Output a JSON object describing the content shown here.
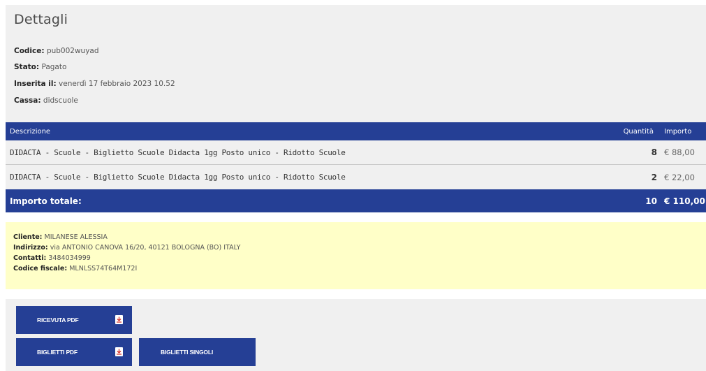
{
  "details": {
    "title": "Dettagli",
    "codice_label": "Codice:",
    "codice_value": "pub002wuyad",
    "stato_label": "Stato:",
    "stato_value": "Pagato",
    "inserita_label": "Inserita il:",
    "inserita_value": "venerdì 17 febbraio 2023 10.52",
    "cassa_label": "Cassa:",
    "cassa_value": "didscuole"
  },
  "table": {
    "headers": {
      "description": "Descrizione",
      "quantity": "Quantità",
      "amount": "Importo"
    },
    "rows": [
      {
        "description": "DIDACTA - Scuole - Biglietto Scuole Didacta 1gg Posto unico - Ridotto Scuole",
        "quantity": "8",
        "amount": "€ 88,00"
      },
      {
        "description": "DIDACTA - Scuole - Biglietto Scuole Didacta 1gg Posto unico - Ridotto Scuole",
        "quantity": "2",
        "amount": "€ 22,00"
      }
    ],
    "total": {
      "label": "Importo totale:",
      "quantity": "10",
      "amount": "€ 110,00"
    }
  },
  "client": {
    "cliente_label": "Cliente:",
    "cliente_value": "MILANESE ALESSIA",
    "indirizzo_label": "Indirizzo:",
    "indirizzo_value": "via ANTONIO CANOVA 16/20, 40121 BOLOGNA (BO) ITALY",
    "contatti_label": "Contatti:",
    "contatti_value": "3484034999",
    "cf_label": "Codice fiscale:",
    "cf_value": "MLNLSS74T64M172I"
  },
  "actions": {
    "ricevuta_pdf": "RICEVUTA PDF",
    "biglietti_pdf": "BIGLIETTI PDF",
    "biglietti_singoli": "BIGLIETTI SINGOLI"
  },
  "icons": {
    "pdf": "pdf-icon"
  },
  "colors": {
    "accent": "#253f95",
    "panel": "#f0f0f0",
    "client_panel": "#ffffc8"
  }
}
